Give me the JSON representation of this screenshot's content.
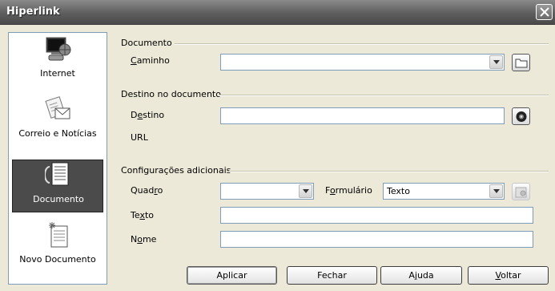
{
  "window": {
    "title": "Hiperlink"
  },
  "sidebar": {
    "items": [
      {
        "label": "Internet",
        "icon": "globe-computer-icon",
        "selected": false
      },
      {
        "label": "Correio e Notícias",
        "icon": "mail-news-icon",
        "selected": false
      },
      {
        "label": "Documento",
        "icon": "document-icon",
        "selected": true
      },
      {
        "label": "Novo Documento",
        "icon": "new-document-icon",
        "selected": false
      }
    ]
  },
  "document_section": {
    "heading": "Documento",
    "path_label": "Caminho",
    "path_value": ""
  },
  "target_section": {
    "heading": "Destino no documento",
    "target_label": "Destino",
    "target_value": "",
    "url_label": "URL"
  },
  "extra_section": {
    "heading": "Configurações adicionais",
    "frame_label": "Quadro",
    "frame_value": "",
    "form_label": "Formulário",
    "form_value": "Texto",
    "text_label": "Texto",
    "text_value": "",
    "name_label": "Nome",
    "name_value": ""
  },
  "buttons": {
    "apply": "Aplicar",
    "close": "Fechar",
    "help": "Ajuda",
    "back": "Voltar"
  }
}
